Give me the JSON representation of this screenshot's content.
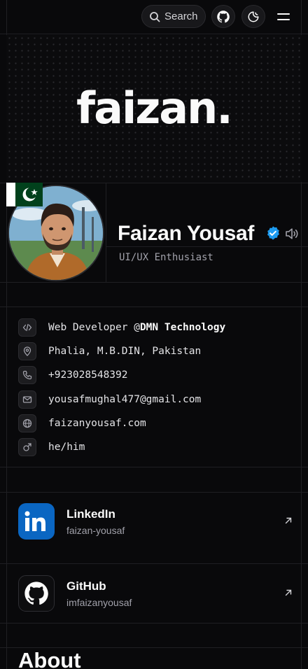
{
  "header": {
    "search_label": "Search",
    "icons": [
      "search-icon",
      "github-icon",
      "theme-toggle-icon",
      "menu-icon"
    ]
  },
  "hero": {
    "wordmark": "faizan."
  },
  "profile": {
    "name": "Faizan Yousaf",
    "tagline": "UI/UX Enthusiast",
    "flag": "pakistan-flag",
    "badges": [
      "verified-badge-icon",
      "speaker-icon"
    ]
  },
  "info": {
    "job_prefix": "Web Developer @",
    "job_company": "DMN Technology",
    "location": "Phalia, M.B.DIN, Pakistan",
    "phone": "+923028548392",
    "email": "yousafmughal477@gmail.com",
    "website": "faizanyousaf.com",
    "pronouns": "he/him"
  },
  "social": [
    {
      "title": "LinkedIn",
      "handle": "faizan-yousaf",
      "icon": "linkedin-icon",
      "color": "#0a66c2"
    },
    {
      "title": "GitHub",
      "handle": "imfaizanyousaf",
      "icon": "github-icon",
      "color": "#0d0d0f"
    }
  ],
  "about": {
    "heading": "About"
  },
  "colors": {
    "background": "#09090b",
    "verified": "#1d9bf0",
    "linkedin": "#0a66c2"
  }
}
